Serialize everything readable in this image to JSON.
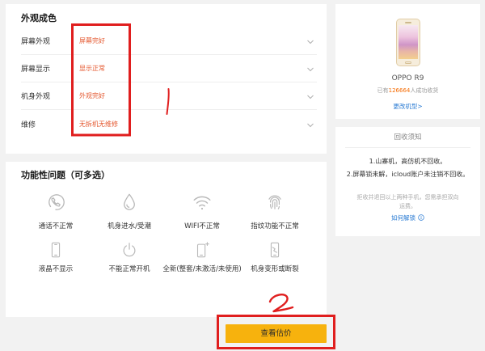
{
  "appearance": {
    "title": "外观成色",
    "rows": [
      {
        "label": "屏幕外观",
        "value": "屏幕完好"
      },
      {
        "label": "屏幕显示",
        "value": "显示正常"
      },
      {
        "label": "机身外观",
        "value": "外观完好"
      },
      {
        "label": "维修",
        "value": "无拆机无维修"
      }
    ],
    "row_icon": "chevron-down-icon"
  },
  "functional": {
    "title": "功能性问题（可多选）",
    "items": [
      {
        "label": "通话不正常",
        "icon": "phone-call-icon"
      },
      {
        "label": "机身进水/受潮",
        "icon": "water-drop-icon"
      },
      {
        "label": "WIFI不正常",
        "icon": "wifi-icon"
      },
      {
        "label": "指纹功能不正常",
        "icon": "fingerprint-icon"
      },
      {
        "label": "液晶不显示",
        "icon": "screen-phone-icon"
      },
      {
        "label": "不能正常开机",
        "icon": "power-icon"
      },
      {
        "label": "全新(整套/未激活/未使用)",
        "icon": "new-phone-icon"
      },
      {
        "label": "机身变形或断裂",
        "icon": "cracked-phone-icon"
      }
    ]
  },
  "device": {
    "model": "OPPO R9",
    "count_prefix": "已有",
    "count": "126664",
    "count_suffix": "人成功收货",
    "change_link": "更改机型>"
  },
  "notice": {
    "title": "回收须知",
    "rules": [
      "1.山寨机，高仿机不回收。",
      "2.屏幕锁未解，icloud账户未注销不回收。"
    ],
    "note_lines": [
      "拒收并退回以上两种手机，您需承担双向",
      "运费。"
    ],
    "unlock_link": "如何解锁",
    "unlock_icon": "info-circle-icon"
  },
  "submit": {
    "label": "查看估价"
  },
  "colors": {
    "accent": "#f7b20d",
    "value_text": "#e4572e",
    "link": "#2a7bd3",
    "count_highlight": "#f56a00",
    "annotation": "#e01e1e"
  }
}
